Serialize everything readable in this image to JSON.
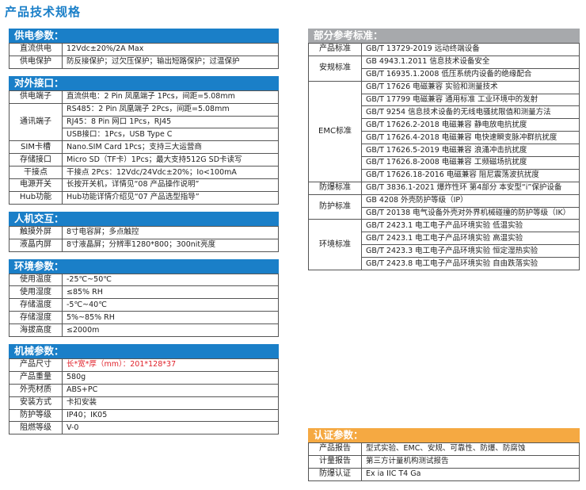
{
  "page_title": "产品技术规格",
  "left": [
    {
      "title": "供电参数：",
      "rows": [
        {
          "k": "直流供电",
          "v": [
            "12Vdc±20%/2A Max"
          ]
        },
        {
          "k": "供电保护",
          "v": [
            "防反接保护；过欠压保护；输出短路保护；过温保护"
          ]
        }
      ]
    },
    {
      "title": "对外接口：",
      "rows": [
        {
          "k": "供电端子",
          "v": [
            "直流供电：2 Pin 凤凰端子 1Pcs，间距=5.08mm"
          ]
        },
        {
          "k": "通讯端子",
          "v": [
            "RS485：2 Pin 凤凰端子 2Pcs，间距=5.08mm",
            "RJ45：8 Pin 网口 1Pcs，RJ45",
            "USB接口：1Pcs，USB Type C"
          ]
        },
        {
          "k": "SIM卡槽",
          "v": [
            "Nano.SIM Card 1Pcs；支持三大运营商"
          ]
        },
        {
          "k": "存储接口",
          "v": [
            "Micro SD（TF卡）1Pcs；最大支持512G SD卡读写"
          ]
        },
        {
          "k": "干接点",
          "v": [
            "干接点 2Pcs：12Vdc/24Vdc±20%；Io<100mA"
          ]
        },
        {
          "k": "电源开关",
          "v": [
            "长按开关机，详情见“08 产品操作说明”"
          ]
        },
        {
          "k": "Hub功能",
          "v": [
            "Hub功能详情介绍见“07 产品选型指导”"
          ]
        }
      ]
    },
    {
      "title": "人机交互：",
      "rows": [
        {
          "k": "触摸外屏",
          "v": [
            "8寸电容屏；多点触控"
          ]
        },
        {
          "k": "液晶内屏",
          "v": [
            "8寸液晶屏；分辨率1280*800；300nit亮度"
          ]
        }
      ]
    },
    {
      "title": "环境参数：",
      "rows": [
        {
          "k": "使用温度",
          "v": [
            "-25℃~50℃"
          ]
        },
        {
          "k": "使用湿度",
          "v": [
            "≤85% RH"
          ]
        },
        {
          "k": "存储温度",
          "v": [
            "-5℃~40℃"
          ]
        },
        {
          "k": "存储湿度",
          "v": [
            "5%~85% RH"
          ]
        },
        {
          "k": "海拔高度",
          "v": [
            "≤2000m"
          ]
        }
      ]
    },
    {
      "title": "机械参数：",
      "rows": [
        {
          "k": "产品尺寸",
          "v": [
            "长*宽*厚（mm）：201*128*37"
          ],
          "red": true
        },
        {
          "k": "产品重量",
          "v": [
            "580g"
          ]
        },
        {
          "k": "外壳材质",
          "v": [
            "ABS+PC"
          ]
        },
        {
          "k": "安装方式",
          "v": [
            "卡扣安装"
          ]
        },
        {
          "k": "防护等级",
          "v": [
            "IP40；IK05"
          ]
        },
        {
          "k": "阻燃等级",
          "v": [
            "V-0"
          ]
        }
      ]
    }
  ],
  "standards": {
    "title": "部分参考标准：",
    "rows": [
      {
        "k": "产品标准",
        "v": [
          "GB/T 13729-2019 远动终端设备"
        ]
      },
      {
        "k": "安规标准",
        "v": [
          "GB 4943.1.2011 信息技术设备安全",
          "GB/T 16935.1.2008 低压系统内设备的绝缘配合"
        ]
      },
      {
        "k": "EMC标准",
        "v": [
          "GB/T 17626 电磁兼容 实验和测量技术",
          "GB/T 17799 电磁兼容 通用标准 工业环境中的发射",
          "GB/T 9254 信息技术设备的无线电骚扰限值和测量方法",
          "GB/T 17626.2-2018 电磁兼容 静电放电抗扰度",
          "GB/T 17626.4-2018 电磁兼容 电快速瞬变脉冲群抗扰度",
          "GB/T 17626.5-2019 电磁兼容 浪涌冲击抗扰度",
          "GB/T 17626.8-2008 电磁兼容 工频磁场抗扰度",
          "GB/T 17626.18-2016 电磁兼容 阻尼震荡波抗扰度"
        ]
      },
      {
        "k": "防爆标准",
        "v": [
          "GB/T 3836.1-2021 爆炸性环 第4部分 本安型“i”保护设备"
        ]
      },
      {
        "k": "防护标准",
        "v": [
          "GB 4208 外壳防护等级（IP）",
          "GB/T 20138 电气设备外壳对外界机械碰撞的防护等级（IK）"
        ]
      },
      {
        "k": "环境标准",
        "v": [
          "GB/T 2423.1 电工电子产品环境实验 低温实验",
          "GB/T 2423.1 电工电子产品环境实验 高温实验",
          "GB/T 2423.3 电工电子产品环境实验 恒定湿热实验",
          "GB/T 2423.8 电工电子产品环境实验 自由跌落实验"
        ]
      }
    ]
  },
  "certs": {
    "title": "认证参数：",
    "rows": [
      {
        "k": "产品报告",
        "v": [
          "型式实验、EMC、安规、可靠性、防爆、防腐蚀"
        ]
      },
      {
        "k": "计量报告",
        "v": [
          "第三方计量机构测试报告"
        ]
      },
      {
        "k": "防爆认证",
        "v": [
          "Ex ia IIC T4 Ga"
        ]
      }
    ]
  }
}
